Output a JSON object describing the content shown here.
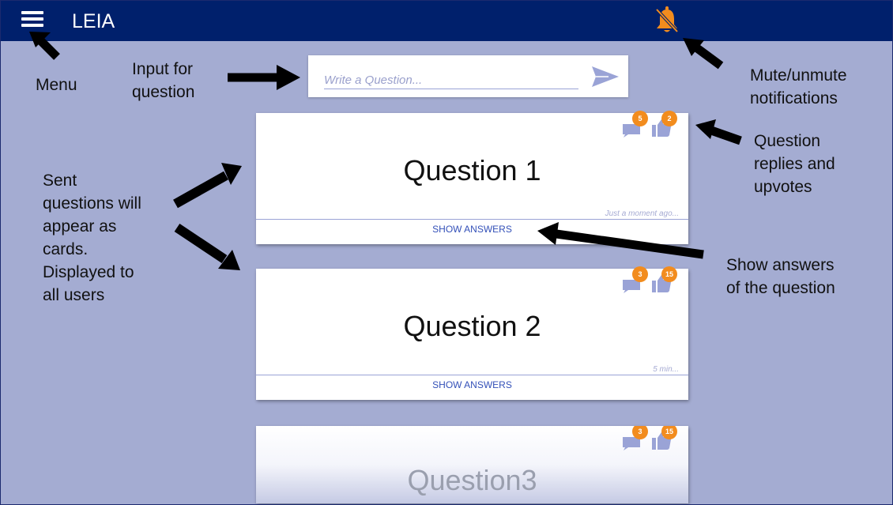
{
  "header": {
    "title": "LEIA",
    "menu_icon": "menu-icon",
    "bell_icon": "bell-off-icon",
    "bell_color": "#f28c1e"
  },
  "ask": {
    "placeholder": "Write a Question...",
    "send_icon": "send-icon"
  },
  "cards": [
    {
      "question": "Question 1",
      "replies": "5",
      "upvotes": "2",
      "time": "Just a moment ago...",
      "show_answers": "SHOW ANSWERS"
    },
    {
      "question": "Question 2",
      "replies": "3",
      "upvotes": "15",
      "time": "5 min...",
      "show_answers": "SHOW ANSWERS"
    },
    {
      "question": "Question3",
      "replies": "3",
      "upvotes": "15"
    }
  ],
  "annotations": {
    "menu": "Menu",
    "input_line1": "Input for",
    "input_line2": "question",
    "mute_line1": "Mute/unmute",
    "mute_line2": "notifications",
    "replies_line1": "Question",
    "replies_line2": "replies and",
    "replies_line3": "upvotes",
    "cards_line1": "Sent",
    "cards_line2": "questions will",
    "cards_line3": "appear as",
    "cards_line4": "cards.",
    "cards_line5": "Displayed to",
    "cards_line6": "all users",
    "show_line1": "Show answers",
    "show_line2": "of the question"
  },
  "colors": {
    "header": "#00206c",
    "background": "#a4acd2",
    "badge": "#f28c1e",
    "link": "#3350b8",
    "icon": "#9aa3d6"
  }
}
